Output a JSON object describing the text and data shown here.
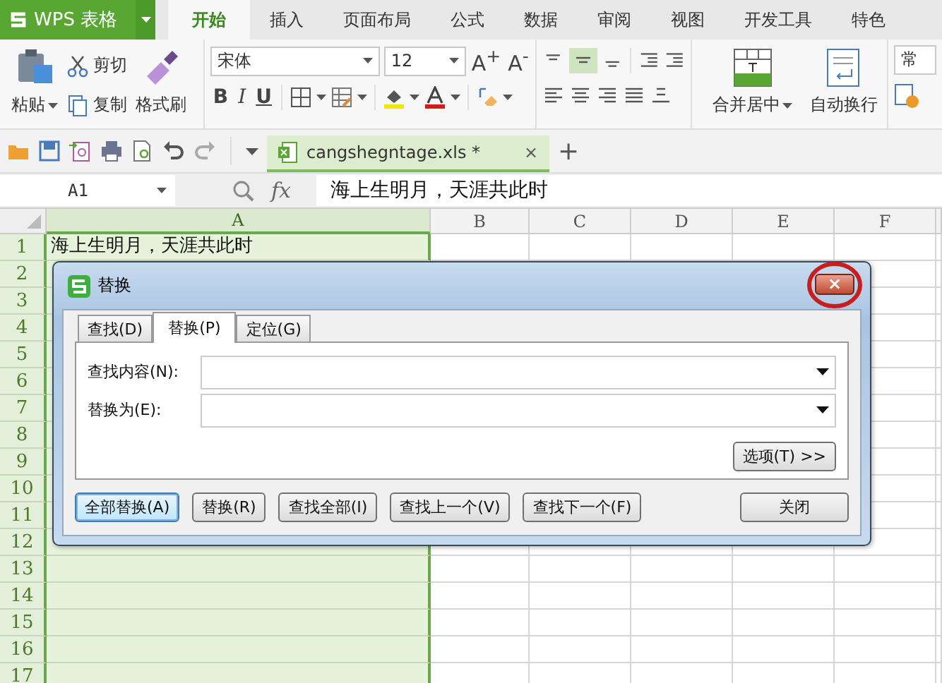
{
  "app_button": {
    "label": "WPS 表格"
  },
  "menu_tabs": [
    {
      "label": "开始",
      "selected": true
    },
    {
      "label": "插入",
      "selected": false
    },
    {
      "label": "页面布局",
      "selected": false
    },
    {
      "label": "公式",
      "selected": false
    },
    {
      "label": "数据",
      "selected": false
    },
    {
      "label": "审阅",
      "selected": false
    },
    {
      "label": "视图",
      "selected": false
    },
    {
      "label": "开发工具",
      "selected": false
    },
    {
      "label": "特色",
      "selected": false
    }
  ],
  "ribbon": {
    "paste": "粘贴",
    "cut": "剪切",
    "copy": "复制",
    "format_painter": "格式刷",
    "font_name": "宋体",
    "font_size": "12",
    "grow_font": "A$^{+}$",
    "shrink_font": "A$^{-}$",
    "bold": "B",
    "italic": "I",
    "underline": "U",
    "merge_center": "合并居中",
    "wrap_text": "自动换行",
    "number_format": "常"
  },
  "document_tab": {
    "name": "cangshegntage.xls *",
    "close": "×",
    "new_tab": "+"
  },
  "formula_bar": {
    "cell": "A1",
    "fx": "fx",
    "content": "海上生明月，天涯共此时"
  },
  "sheet": {
    "columns": [
      {
        "label": "A",
        "selected": true
      },
      {
        "label": "B",
        "selected": false
      },
      {
        "label": "C",
        "selected": false
      },
      {
        "label": "D",
        "selected": false
      },
      {
        "label": "E",
        "selected": false
      },
      {
        "label": "F",
        "selected": false
      }
    ],
    "rows": [
      "1",
      "2",
      "3",
      "4",
      "5",
      "6",
      "7",
      "8",
      "9",
      "10",
      "11",
      "12",
      "13",
      "14",
      "15",
      "16",
      "17"
    ],
    "cell_a1": "海上生明月，天涯共此时"
  },
  "dialog": {
    "title": "替换",
    "close": "×",
    "tabs": [
      {
        "label": "查找(D)",
        "selected": false
      },
      {
        "label": "替换(P)",
        "selected": true
      },
      {
        "label": "定位(G)",
        "selected": false
      }
    ],
    "fields": [
      {
        "label": "查找内容(N):"
      },
      {
        "label": "替换为(E):"
      }
    ],
    "options_button": "选项(T) >>",
    "buttons": [
      {
        "label": "全部替换(A)",
        "focused": true
      },
      {
        "label": "替换(R)",
        "focused": false
      },
      {
        "label": "查找全部(I)",
        "focused": false
      },
      {
        "label": "查找上一个(V)",
        "focused": false
      },
      {
        "label": "查找下一个(F)",
        "focused": false
      }
    ],
    "close_button": "关闭"
  }
}
